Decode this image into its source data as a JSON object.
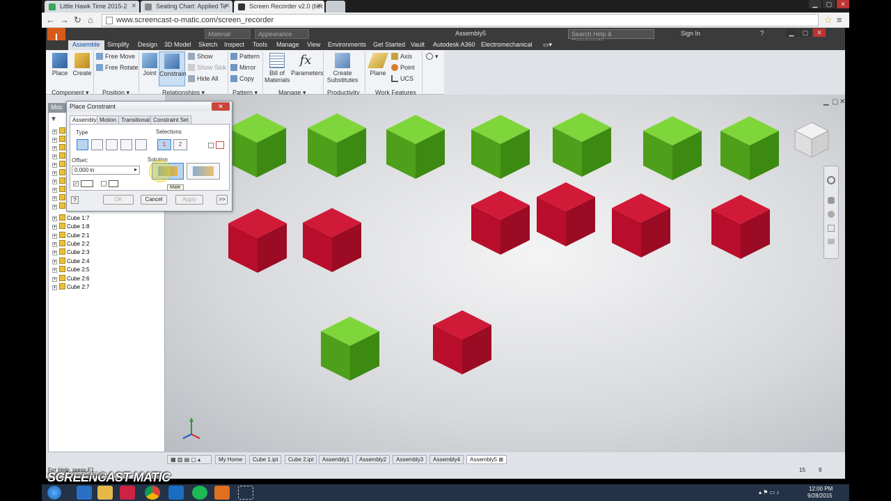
{
  "browser": {
    "tabs": [
      {
        "label": "Little Hawk Time 2015-2"
      },
      {
        "label": "Seating Chart: Applied Te"
      },
      {
        "label": "Screen Recorder v2.0 (bet"
      }
    ],
    "url": "www.screencast-o-matic.com/screen_recorder"
  },
  "app": {
    "title": "Assembly5",
    "logo_text": "I",
    "material_placeholder": "Material",
    "appearance_placeholder": "Appearance",
    "help_search": "Search Help & Commands...",
    "sign_in": "Sign In",
    "menu_tabs": [
      "Assemble",
      "Simplify",
      "Design",
      "3D Model",
      "Sketch",
      "Inspect",
      "Tools",
      "Manage",
      "View",
      "Environments",
      "Get Started",
      "Vault",
      "Autodesk A360",
      "Electromechanical"
    ]
  },
  "ribbon": {
    "place": "Place",
    "create": "Create",
    "free_move": "Free Move",
    "free_rotate": "Free Rotate",
    "joint": "Joint",
    "constrain": "Constrain",
    "show": "Show",
    "show_sick": "Show Sick",
    "hide_all": "Hide All",
    "pattern": "Pattern",
    "mirror": "Mirror",
    "copy": "Copy",
    "bom_line1": "Bill of",
    "bom_line2": "Materials",
    "parameters": "Parameters",
    "create_subs_line1": "Create",
    "create_subs_line2": "Substitutes",
    "plane": "Plane",
    "axis": "Axis",
    "point": "Point",
    "ucs": "UCS",
    "groups": {
      "component": "Component",
      "position": "Position",
      "relationships": "Relationships",
      "pattern": "Pattern",
      "manage": "Manage",
      "productivity": "Productivity",
      "work_features": "Work Features"
    }
  },
  "model_browser": {
    "header": "Moc",
    "items": [
      "Cube 1:7",
      "Cube 1:8",
      "Cube 2:1",
      "Cube 2:2",
      "Cube 2:3",
      "Cube 2:4",
      "Cube 2:5",
      "Cube 2:6",
      "Cube 2:7"
    ]
  },
  "dialog": {
    "title": "Place Constraint",
    "close": "✕",
    "tabs": [
      "Assembly",
      "Motion",
      "Transitional",
      "Constraint Set"
    ],
    "type_label": "Type",
    "selections_label": "Selections",
    "offset_label": "Offset:",
    "offset_value": "0.000 in",
    "solution_label": "Solution",
    "tooltip": "Mate",
    "ok": "OK",
    "cancel": "Cancel",
    "apply": "Apply",
    "more": ">>"
  },
  "doc_tabs": [
    "My Home",
    "Cube 1.ipt",
    "Cube 2.ipt",
    "Assembly1",
    "Assembly2",
    "Assembly3",
    "Assembly4",
    "Assembly5"
  ],
  "status": {
    "help_text": "For Help, press F1",
    "count_a": "15",
    "count_b": "9"
  },
  "watermark": {
    "brand": "SCREENCAST MATIC",
    "sub": "Recorded with"
  },
  "tray": {
    "time": "12:00 PM",
    "date": "9/28/2015"
  },
  "colors": {
    "green_cube": "#5cb81e",
    "red_cube": "#c8102e",
    "accent": "#0a4d9c"
  }
}
